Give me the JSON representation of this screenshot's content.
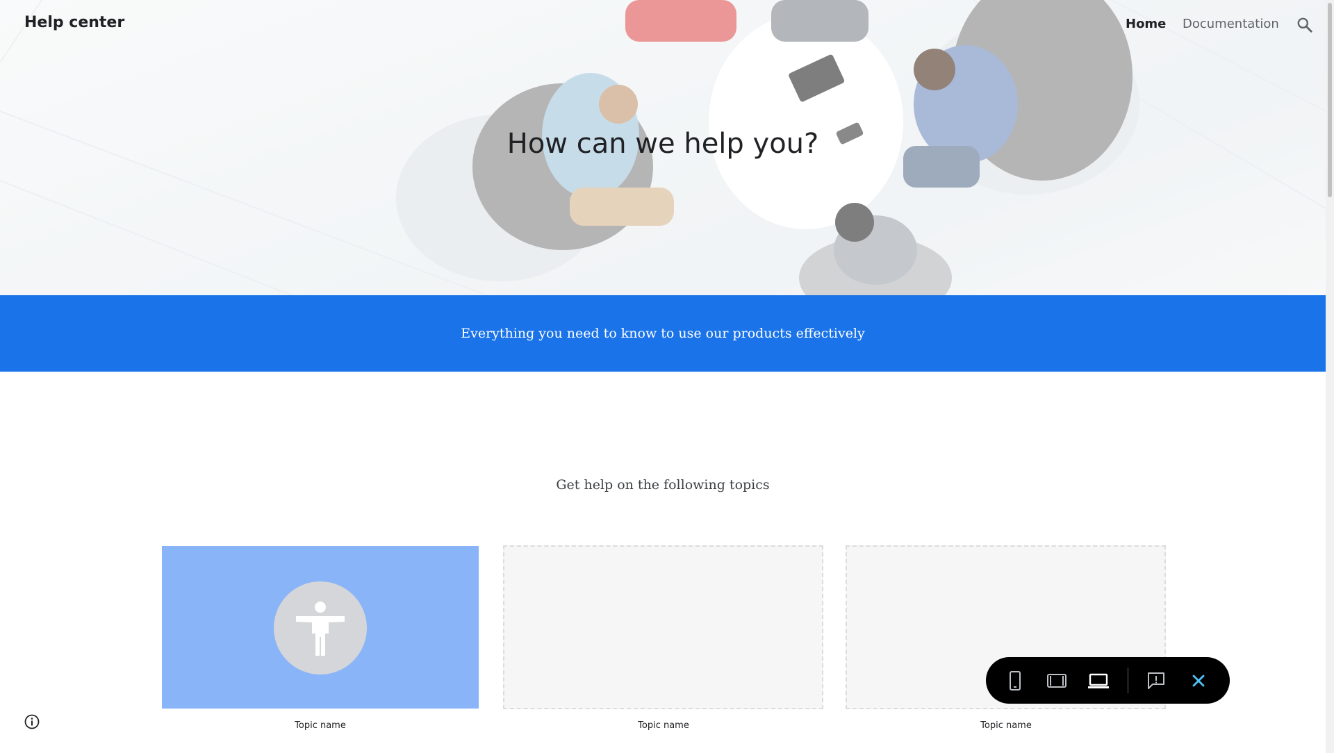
{
  "header": {
    "brand": "Help center",
    "nav": [
      {
        "label": "Home",
        "active": true
      },
      {
        "label": "Documentation",
        "active": false
      }
    ],
    "search_icon": "search-icon"
  },
  "hero": {
    "title": "How can we help you?"
  },
  "banner": {
    "text": "Everything you need to know to use our products effectively",
    "color": "#1a73e8"
  },
  "topics": {
    "heading": "Get help on the following topics",
    "items": [
      {
        "label": "Topic name",
        "icon": "accessibility-icon",
        "placeholder": false
      },
      {
        "label": "Topic name",
        "placeholder": true
      },
      {
        "label": "Topic name",
        "placeholder": true
      }
    ]
  },
  "preview_toolbar": {
    "buttons": [
      {
        "icon": "phone-icon"
      },
      {
        "icon": "tablet-icon"
      },
      {
        "icon": "laptop-icon",
        "active": true
      },
      {
        "icon": "report-issue-icon"
      },
      {
        "icon": "close-icon"
      }
    ]
  },
  "colors": {
    "accent": "#1a73e8",
    "card_fill": "#8ab4f8",
    "toolbar_bg": "#000000",
    "close_icon": "#4fc3f7"
  }
}
